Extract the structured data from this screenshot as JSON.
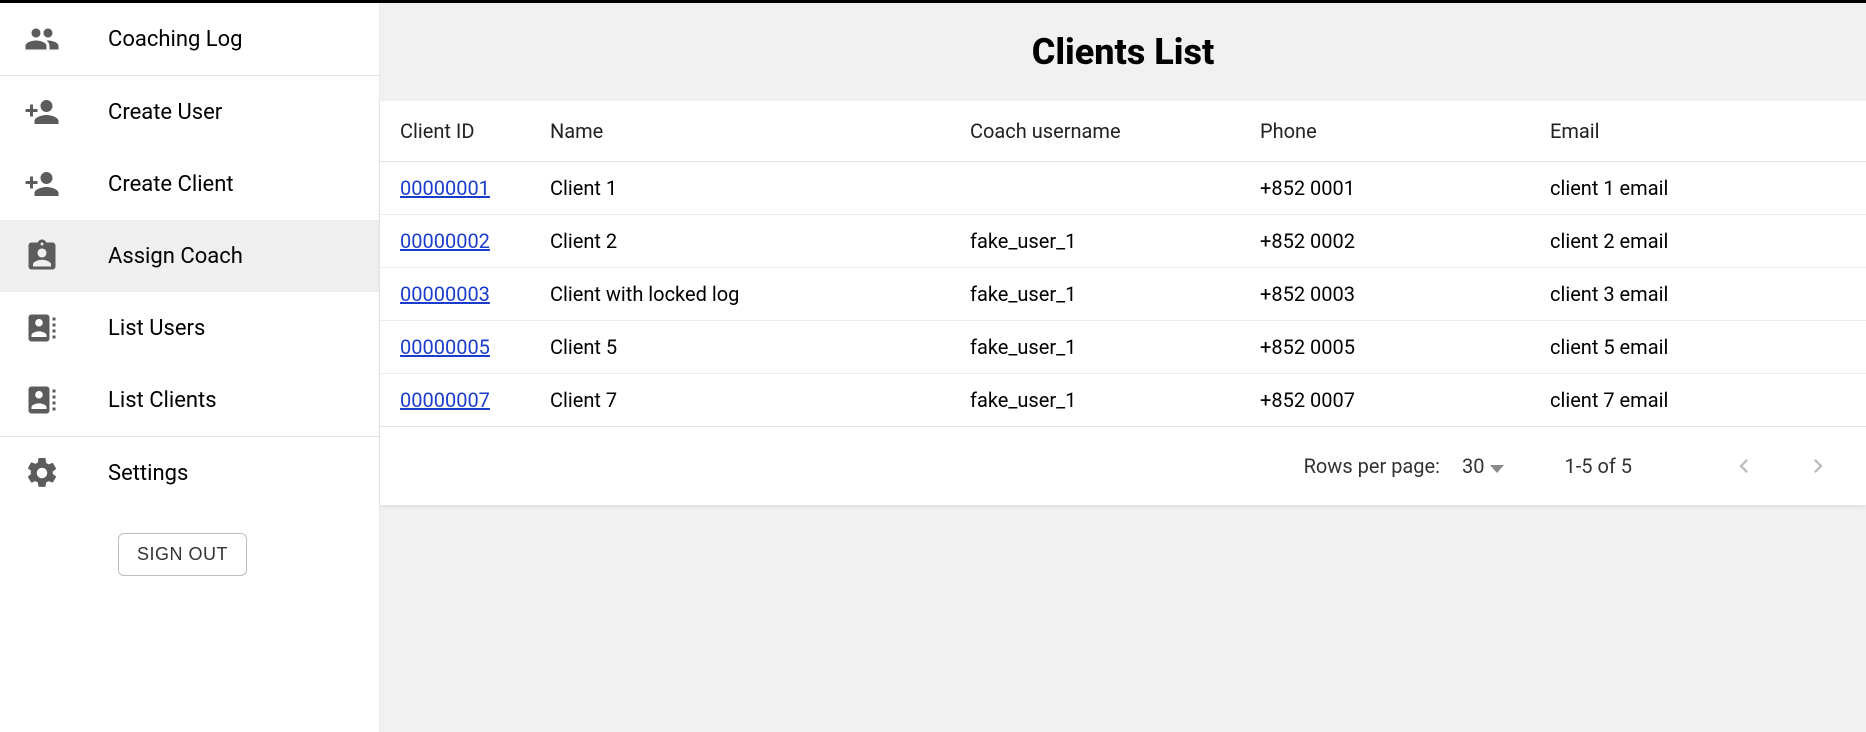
{
  "sidebar": {
    "items": [
      {
        "key": "coaching-log",
        "label": "Coaching Log",
        "icon": "people-icon"
      },
      {
        "key": "create-user",
        "label": "Create User",
        "icon": "person-add-icon"
      },
      {
        "key": "create-client",
        "label": "Create Client",
        "icon": "person-add-icon"
      },
      {
        "key": "assign-coach",
        "label": "Assign Coach",
        "icon": "clipboard-person-icon",
        "active": true
      },
      {
        "key": "list-users",
        "label": "List Users",
        "icon": "contact-list-icon"
      },
      {
        "key": "list-clients",
        "label": "List Clients",
        "icon": "contact-list-icon"
      },
      {
        "key": "settings",
        "label": "Settings",
        "icon": "gear-icon"
      }
    ],
    "signout_label": "SIGN OUT"
  },
  "main": {
    "title": "Clients List",
    "columns": {
      "client_id": "Client ID",
      "name": "Name",
      "coach": "Coach username",
      "phone": "Phone",
      "email": "Email"
    },
    "rows": [
      {
        "client_id": "00000001",
        "name": "Client 1",
        "coach": "",
        "phone": "+852 0001",
        "email": "client 1 email"
      },
      {
        "client_id": "00000002",
        "name": "Client 2",
        "coach": "fake_user_1",
        "phone": "+852 0002",
        "email": "client 2 email"
      },
      {
        "client_id": "00000003",
        "name": "Client with locked log",
        "coach": "fake_user_1",
        "phone": "+852 0003",
        "email": "client 3 email"
      },
      {
        "client_id": "00000005",
        "name": "Client 5",
        "coach": "fake_user_1",
        "phone": "+852 0005",
        "email": "client 5 email"
      },
      {
        "client_id": "00000007",
        "name": "Client 7",
        "coach": "fake_user_1",
        "phone": "+852 0007",
        "email": "client 7 email"
      }
    ],
    "footer": {
      "rows_per_page_label": "Rows per page:",
      "rows_per_page_value": "30",
      "range": "1-5 of 5"
    }
  }
}
